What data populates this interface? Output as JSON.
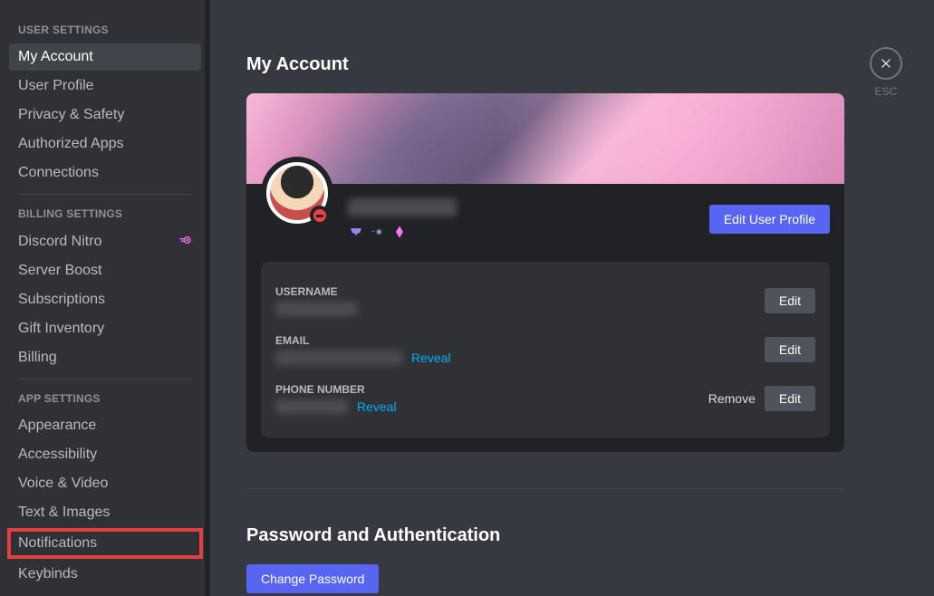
{
  "sidebar": {
    "sections": [
      {
        "title": "USER SETTINGS",
        "items": [
          {
            "label": "My Account",
            "active": true
          },
          {
            "label": "User Profile"
          },
          {
            "label": "Privacy & Safety"
          },
          {
            "label": "Authorized Apps"
          },
          {
            "label": "Connections"
          }
        ]
      },
      {
        "title": "BILLING SETTINGS",
        "items": [
          {
            "label": "Discord Nitro",
            "badge": true
          },
          {
            "label": "Server Boost"
          },
          {
            "label": "Subscriptions"
          },
          {
            "label": "Gift Inventory"
          },
          {
            "label": "Billing"
          }
        ]
      },
      {
        "title": "APP SETTINGS",
        "items": [
          {
            "label": "Appearance"
          },
          {
            "label": "Accessibility"
          },
          {
            "label": "Voice & Video"
          },
          {
            "label": "Text & Images"
          },
          {
            "label": "Notifications",
            "highlight": true
          },
          {
            "label": "Keybinds"
          }
        ]
      }
    ]
  },
  "content": {
    "page_title": "My Account",
    "close_label": "ESC",
    "edit_profile": "Edit User Profile",
    "details": [
      {
        "label": "USERNAME",
        "reveal": null,
        "actions": [
          "Edit"
        ],
        "blur_width": 90
      },
      {
        "label": "EMAIL",
        "reveal": "Reveal",
        "actions": [
          "Edit"
        ],
        "blur_width": 140
      },
      {
        "label": "PHONE NUMBER",
        "reveal": "Reveal",
        "actions": [
          "Remove",
          "Edit"
        ],
        "blur_width": 80
      }
    ],
    "password_section_title": "Password and Authentication",
    "change_password": "Change Password",
    "edit_label": "Edit",
    "remove_label": "Remove",
    "reveal_label": "Reveal"
  }
}
